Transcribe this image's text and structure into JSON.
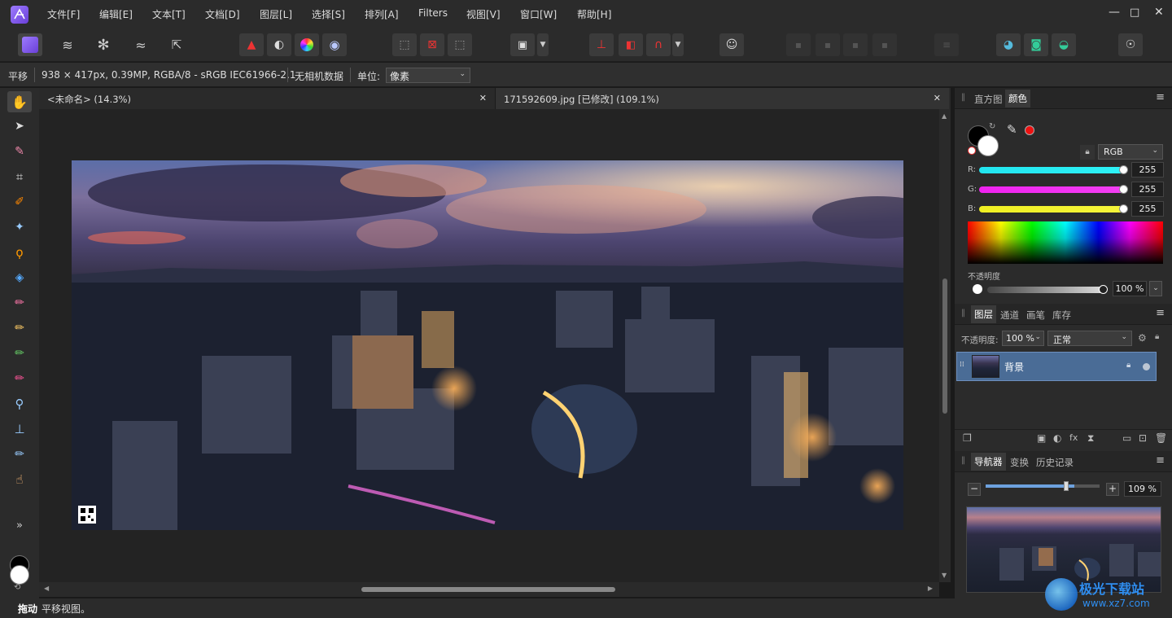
{
  "menu": [
    "文件[F]",
    "编辑[E]",
    "文本[T]",
    "文档[D]",
    "图层[L]",
    "选择[S]",
    "排列[A]",
    "Filters",
    "视图[V]",
    "窗口[W]",
    "帮助[H]"
  ],
  "window_controls": {
    "minimize": "—",
    "maximize": "□",
    "close": "✕"
  },
  "context": {
    "tool_name": "平移",
    "doc_info": "938 × 417px, 0.39MP, RGBA/8 - sRGB IEC61966-2.1",
    "camera_data": "无相机数据",
    "unit_label": "单位:",
    "unit_value": "像素"
  },
  "tabs": [
    {
      "label": "<未命名> (14.3%)",
      "close": "✕"
    },
    {
      "label": "171592609.jpg [已修改] (109.1%)",
      "close": "✕"
    }
  ],
  "color_panel": {
    "tabs": [
      "直方图",
      "颜色"
    ],
    "model": "RGB",
    "channels": [
      {
        "label": "R:",
        "value": "255",
        "color": "#22e5ef"
      },
      {
        "label": "G:",
        "value": "255",
        "color": "#ef22ef"
      },
      {
        "label": "B:",
        "value": "255",
        "color": "#efef22"
      }
    ],
    "opacity_label": "不透明度",
    "opacity_value": "100 %"
  },
  "layers_panel": {
    "tabs": [
      "图层",
      "通道",
      "画笔",
      "库存"
    ],
    "opacity_label": "不透明度:",
    "opacity_value": "100 %",
    "blend_mode": "正常",
    "layers": [
      {
        "name": "背景"
      }
    ]
  },
  "navigator_panel": {
    "tabs": [
      "导航器",
      "变换",
      "历史记录"
    ],
    "zoom_value": "109 %",
    "zoom_fraction": 0.78
  },
  "status": {
    "action": "拖动",
    "message": "平移视图。"
  },
  "watermark": {
    "line1": "极光下载站",
    "line2": "www.xz7.com"
  },
  "colors": {
    "accent": "#8b6cff",
    "selected_layer": "#4a6c96"
  }
}
